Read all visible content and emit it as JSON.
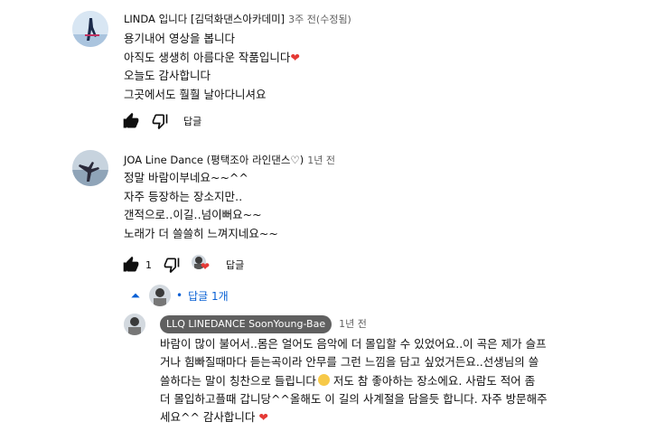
{
  "comments": [
    {
      "author": "LINDA 입니다 [김덕화댄스아카데미]",
      "time": "3주 전(수정됨)",
      "lines": [
        "용기내어 영상을 봅니다",
        "아직도 생생히 아름다운 작품입니다",
        "오늘도 감사합니다",
        "그곳에서도 훨훨 날아다니셔요"
      ],
      "reply_label": "답글"
    },
    {
      "author": "JOA Line Dance (평택조아 라인댄스♡)",
      "time": "1년 전",
      "lines": [
        "정말 바람이부네요~~^^",
        "자주 등장하는 장소지만‥",
        "갠적으로‥이길‥넘이뻐요~~",
        "노래가 더 쓸쓸히 느껴지네요~~"
      ],
      "like_count": "1",
      "reply_label": "답글",
      "replies_toggle": "답글 1개"
    }
  ],
  "reply": {
    "author": "LLQ LINEDANCE SoonYoung-Bae",
    "time": "1년 전",
    "lines": [
      "바람이 많이 불어서..몸은 얼어도 음악에 더 몰입할 수 있었어요..이 곡은 제가 슬프",
      "거나 힘빠질때마다 듣는곡이라 안무를 그런 느낌을 담고 싶었거든요..선생님의 쓸",
      "쓸하다는 말이 칭찬으로 들립니다",
      "더 몰입하고플때 갑니당^^올해도 이 길의  사계절을 담을듯 합니다. 자주 방문해주",
      "세요^^ 감사합니다"
    ],
    "line3_tail": " 저도 참 좋아하는 장소에요. 사람도 적어 좀"
  },
  "colors": {
    "heart": "#e53935",
    "link": "#065fd4",
    "chip_bg": "#606060"
  }
}
